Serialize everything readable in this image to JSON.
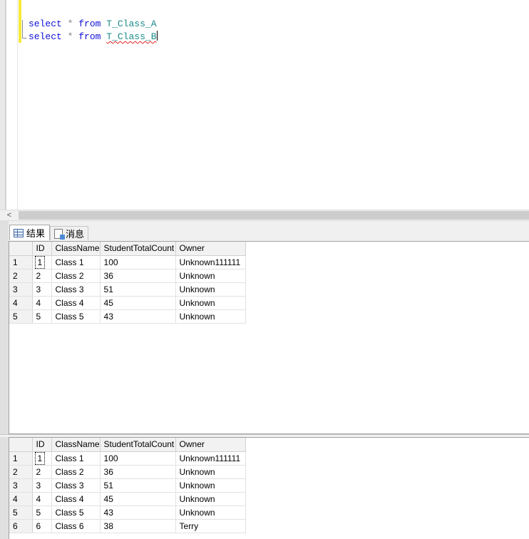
{
  "editor": {
    "lines": [
      {
        "kw1": "select",
        "op": "*",
        "kw2": "from",
        "table": "T_Class_A"
      },
      {
        "kw1": "select",
        "op": "*",
        "kw2": "from",
        "table": "T_Class_B"
      }
    ]
  },
  "scrollbar": {
    "left_arrow": "<"
  },
  "tabs": [
    {
      "label": "结果",
      "icon": "results-grid-icon",
      "active": true
    },
    {
      "label": "消息",
      "icon": "messages-icon",
      "active": false
    }
  ],
  "results": [
    {
      "columns": [
        "ID",
        "ClassName",
        "StudentTotalCount",
        "Owner"
      ],
      "rows": [
        {
          "n": "1",
          "cells": [
            "1",
            "Class 1",
            "100",
            "Unknown111111"
          ]
        },
        {
          "n": "2",
          "cells": [
            "2",
            "Class 2",
            "36",
            "Unknown"
          ]
        },
        {
          "n": "3",
          "cells": [
            "3",
            "Class 3",
            "51",
            "Unknown"
          ]
        },
        {
          "n": "4",
          "cells": [
            "4",
            "Class 4",
            "45",
            "Unknown"
          ]
        },
        {
          "n": "5",
          "cells": [
            "5",
            "Class 5",
            "43",
            "Unknown"
          ]
        }
      ]
    },
    {
      "columns": [
        "ID",
        "ClassName",
        "StudentTotalCount",
        "Owner"
      ],
      "rows": [
        {
          "n": "1",
          "cells": [
            "1",
            "Class 1",
            "100",
            "Unknown111111"
          ]
        },
        {
          "n": "2",
          "cells": [
            "2",
            "Class 2",
            "36",
            "Unknown"
          ]
        },
        {
          "n": "3",
          "cells": [
            "3",
            "Class 3",
            "51",
            "Unknown"
          ]
        },
        {
          "n": "4",
          "cells": [
            "4",
            "Class 4",
            "45",
            "Unknown"
          ]
        },
        {
          "n": "5",
          "cells": [
            "5",
            "Class 5",
            "43",
            "Unknown"
          ]
        },
        {
          "n": "6",
          "cells": [
            "6",
            "Class 6",
            "38",
            "Terry"
          ]
        }
      ]
    }
  ]
}
